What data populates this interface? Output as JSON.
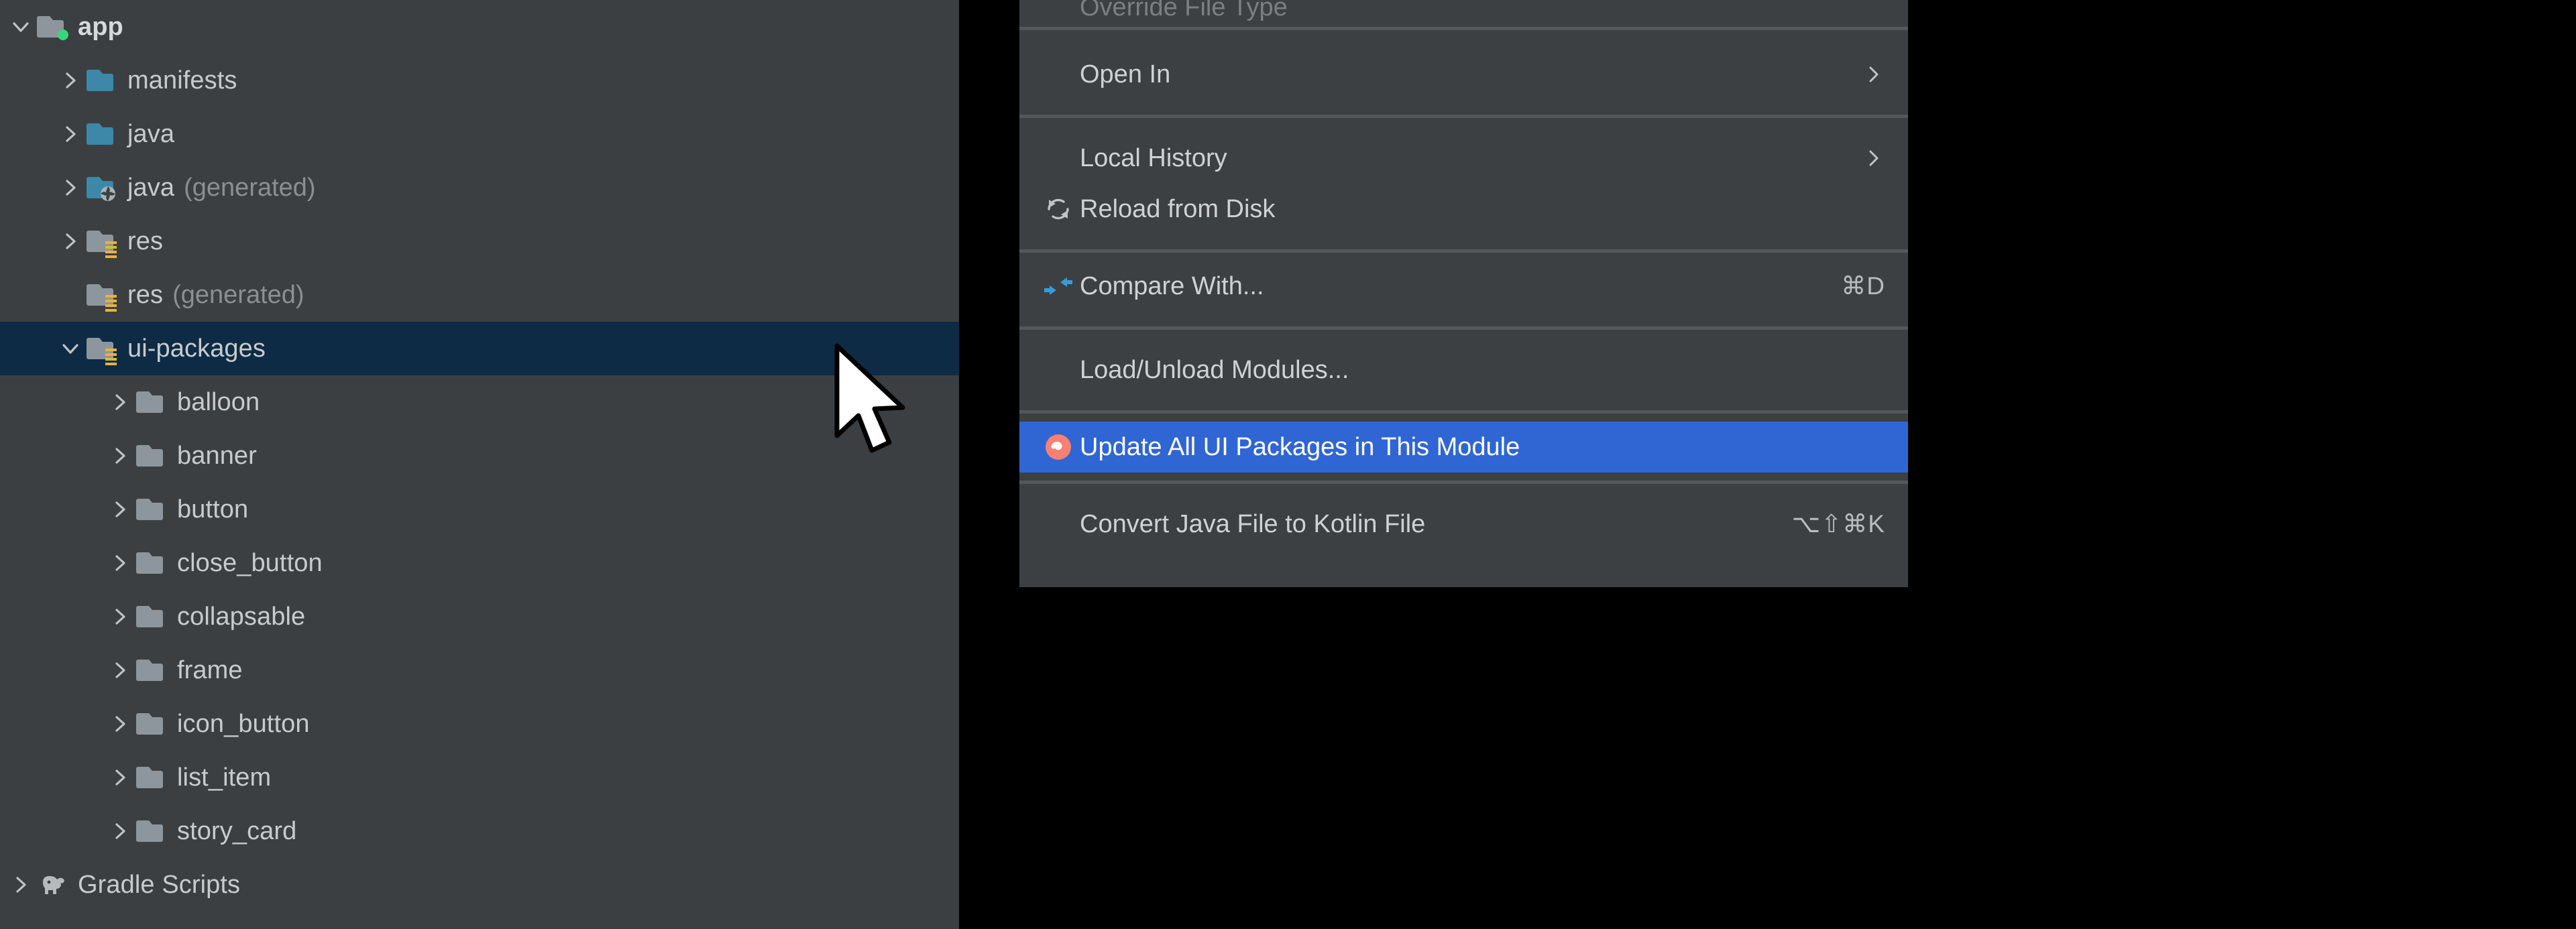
{
  "colors": {
    "panel_bg": "#3c3f41",
    "menu_bg": "#3c4042",
    "selected_row": "#0d2b45",
    "menu_highlight": "#2f66d3",
    "folder_blue": "#3d87a8",
    "folder_grey": "#8d969c",
    "res_stripe": "#e8b33c",
    "badge_green": "#37d67a",
    "compare_icon_blue": "#3a9ad9",
    "update_icon_coral": "#fa8072",
    "separator": "#55585a",
    "text": "#c8cbcc",
    "text_dim": "#8b8f91"
  },
  "project_tree": {
    "name": "Android Project View",
    "rows": [
      {
        "label": "app",
        "suffix": "",
        "indent": 0,
        "arrow": "chevron-down",
        "icon": "module-folder-badge-green",
        "bold": true,
        "selected": false
      },
      {
        "label": "manifests",
        "suffix": "",
        "indent": 1,
        "arrow": "chevron-right",
        "icon": "folder-blue",
        "bold": false,
        "selected": false
      },
      {
        "label": "java",
        "suffix": "",
        "indent": 1,
        "arrow": "chevron-right",
        "icon": "folder-blue",
        "bold": false,
        "selected": false
      },
      {
        "label": "java",
        "suffix": "(generated)",
        "indent": 1,
        "arrow": "chevron-right",
        "icon": "folder-blue-generated",
        "bold": false,
        "selected": false
      },
      {
        "label": "res",
        "suffix": "",
        "indent": 1,
        "arrow": "chevron-right",
        "icon": "folder-res",
        "bold": false,
        "selected": false
      },
      {
        "label": "res",
        "suffix": "(generated)",
        "indent": 1,
        "arrow": "none",
        "icon": "folder-res",
        "bold": false,
        "selected": false
      },
      {
        "label": "ui-packages",
        "suffix": "",
        "indent": 1,
        "arrow": "chevron-down",
        "icon": "folder-res",
        "bold": false,
        "selected": true
      },
      {
        "label": "balloon",
        "suffix": "",
        "indent": 2,
        "arrow": "chevron-right",
        "icon": "folder-grey",
        "bold": false,
        "selected": false
      },
      {
        "label": "banner",
        "suffix": "",
        "indent": 2,
        "arrow": "chevron-right",
        "icon": "folder-grey",
        "bold": false,
        "selected": false
      },
      {
        "label": "button",
        "suffix": "",
        "indent": 2,
        "arrow": "chevron-right",
        "icon": "folder-grey",
        "bold": false,
        "selected": false
      },
      {
        "label": "close_button",
        "suffix": "",
        "indent": 2,
        "arrow": "chevron-right",
        "icon": "folder-grey",
        "bold": false,
        "selected": false
      },
      {
        "label": "collapsable",
        "suffix": "",
        "indent": 2,
        "arrow": "chevron-right",
        "icon": "folder-grey",
        "bold": false,
        "selected": false
      },
      {
        "label": "frame",
        "suffix": "",
        "indent": 2,
        "arrow": "chevron-right",
        "icon": "folder-grey",
        "bold": false,
        "selected": false
      },
      {
        "label": "icon_button",
        "suffix": "",
        "indent": 2,
        "arrow": "chevron-right",
        "icon": "folder-grey",
        "bold": false,
        "selected": false
      },
      {
        "label": "list_item",
        "suffix": "",
        "indent": 2,
        "arrow": "chevron-right",
        "icon": "folder-grey",
        "bold": false,
        "selected": false
      },
      {
        "label": "story_card",
        "suffix": "",
        "indent": 2,
        "arrow": "chevron-right",
        "icon": "folder-grey",
        "bold": false,
        "selected": false
      },
      {
        "label": "Gradle Scripts",
        "suffix": "",
        "indent": 0,
        "arrow": "chevron-right",
        "icon": "gradle-elephant",
        "bold": false,
        "selected": false
      }
    ]
  },
  "context_menu": {
    "name": "project-view-context-menu",
    "items": [
      {
        "label": "Override File Type",
        "shortcut": "",
        "icon": "none",
        "submenu": false,
        "highlighted": false,
        "disabled": true,
        "clipped": true
      },
      {
        "label": "Open In",
        "shortcut": "",
        "icon": "none",
        "submenu": true,
        "highlighted": false,
        "disabled": false,
        "clipped": false
      },
      {
        "label": "Local History",
        "shortcut": "",
        "icon": "none",
        "submenu": true,
        "highlighted": false,
        "disabled": false,
        "clipped": false
      },
      {
        "label": "Reload from Disk",
        "shortcut": "",
        "icon": "reload-icon",
        "submenu": false,
        "highlighted": false,
        "disabled": false,
        "clipped": false
      },
      {
        "label": "Compare With...",
        "shortcut": "⌘D",
        "icon": "compare-icon",
        "submenu": false,
        "highlighted": false,
        "disabled": false,
        "clipped": false
      },
      {
        "label": "Load/Unload Modules...",
        "shortcut": "",
        "icon": "none",
        "submenu": false,
        "highlighted": false,
        "disabled": false,
        "clipped": false
      },
      {
        "label": "Update All UI Packages in This Module",
        "shortcut": "",
        "icon": "update-ui-packages-icon",
        "submenu": false,
        "highlighted": true,
        "disabled": false,
        "clipped": false
      },
      {
        "label": "Convert Java File to Kotlin File",
        "shortcut": "⌥⇧⌘K",
        "icon": "none",
        "submenu": false,
        "highlighted": false,
        "disabled": false,
        "clipped": false
      }
    ]
  },
  "cursor": {
    "name": "mouse-pointer"
  }
}
